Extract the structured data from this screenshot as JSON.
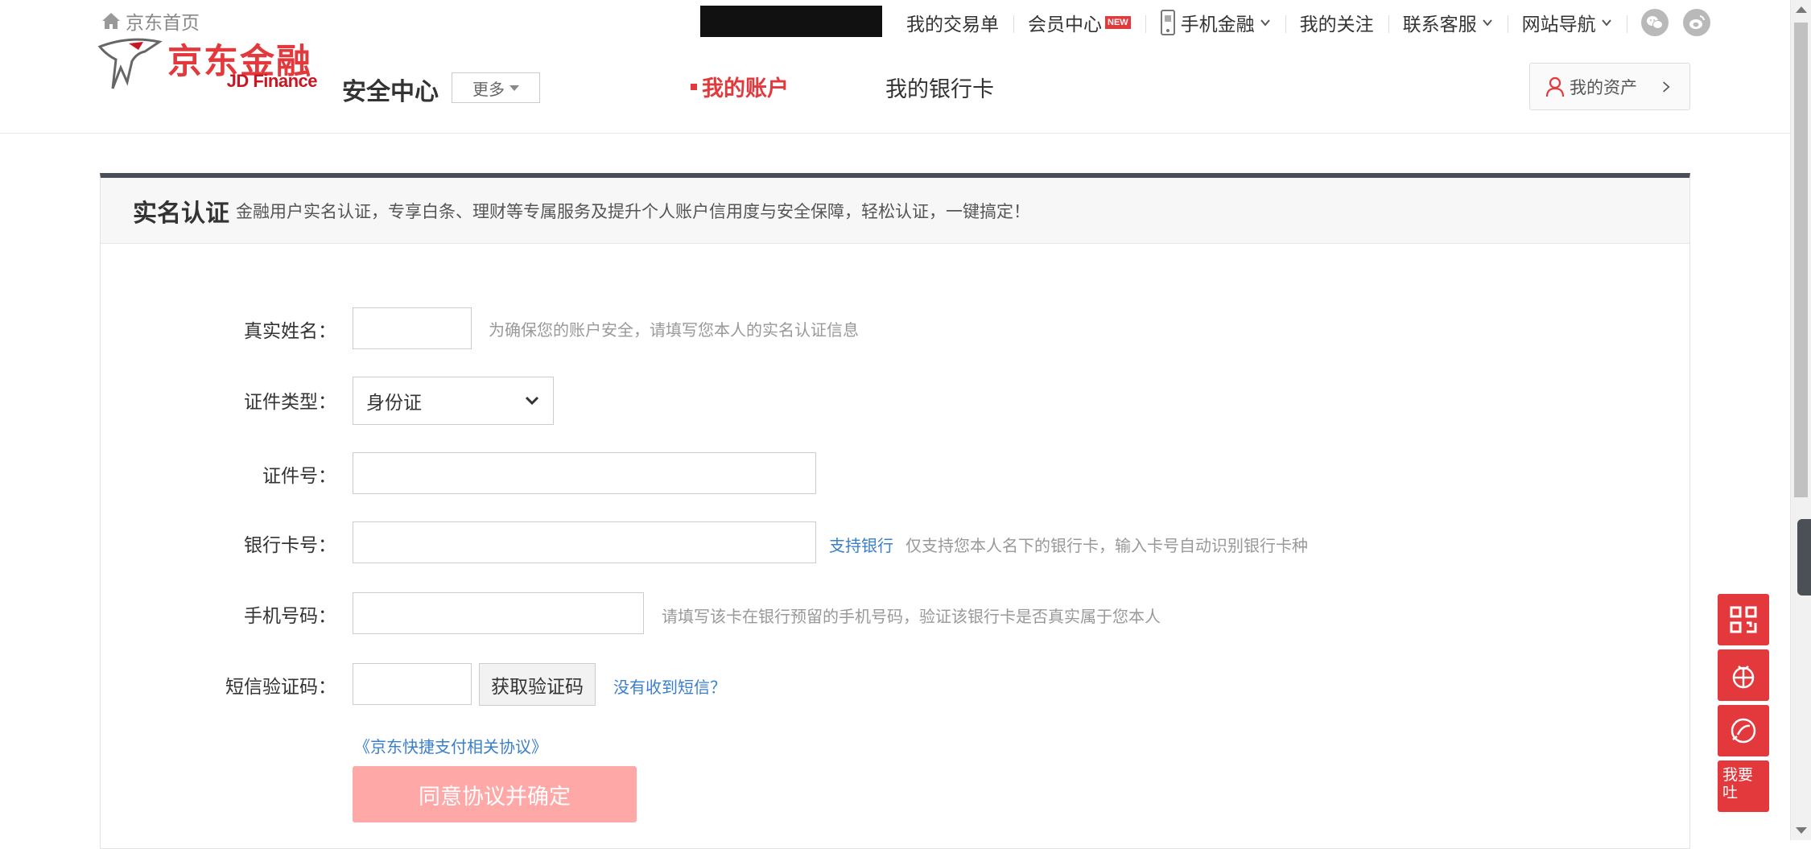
{
  "topbar": {
    "home": "京东首页",
    "nav": {
      "orders": "我的交易单",
      "member": "会员中心",
      "member_badge": "NEW",
      "mobile": "手机金融",
      "follow": "我的关注",
      "service": "联系客服",
      "sitenav": "网站导航"
    },
    "social_icons": [
      "wechat-icon",
      "weibo-icon"
    ]
  },
  "header": {
    "logo_cn": "京东金融",
    "logo_en": "JD Finance",
    "center_title": "安全中心",
    "more": "更多",
    "tabs": {
      "account": "我的账户",
      "bank_card": "我的银行卡"
    },
    "assets": "我的资产"
  },
  "panel": {
    "title": "实名认证",
    "desc": "金融用户实名认证，专享白条、理财等专属服务及提升个人账户信用度与安全保障，轻松认证，一键搞定！"
  },
  "form": {
    "name_label": "真实姓名：",
    "name_hint": "为确保您的账户安全，请填写您本人的实名认证信息",
    "idtype_label": "证件类型：",
    "idtype_value": "身份证",
    "idnum_label": "证件号：",
    "card_label": "银行卡号：",
    "card_link": "支持银行",
    "card_hint": "仅支持您本人名下的银行卡，输入卡号自动识别银行卡种",
    "phone_label": "手机号码：",
    "phone_hint": "请填写该卡在银行预留的手机号码，验证该银行卡是否真实属于您本人",
    "sms_label": "短信验证码：",
    "sms_button": "获取验证码",
    "sms_link": "没有收到短信？",
    "agreement": "《京东快捷支付相关协议》",
    "submit": "同意协议并确定"
  },
  "float_tools": {
    "feedback": "我要吐"
  },
  "colors": {
    "brand_red": "#e4393c",
    "link_blue": "#3a7fcc",
    "submit_disabled": "#ffa8a8"
  }
}
